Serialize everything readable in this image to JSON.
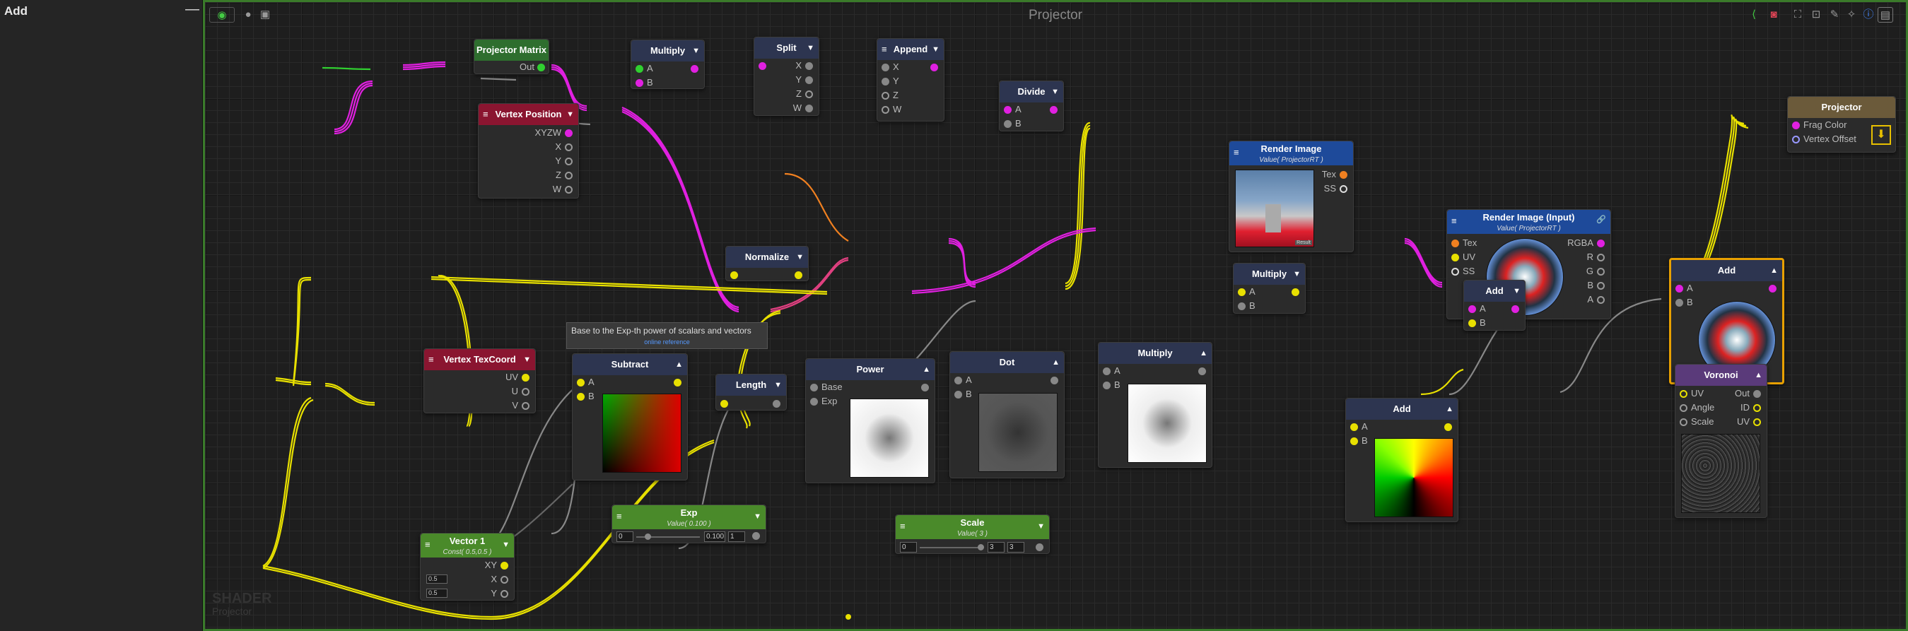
{
  "sidebar": {
    "title": "Add",
    "minimize": "—"
  },
  "graph": {
    "title": "Projector"
  },
  "watermark": {
    "line1": "SHADER",
    "line2": "Projector"
  },
  "colors": {
    "hdr_green": "#2e6e2e",
    "hdr_red": "#8a1530",
    "hdr_navy": "#2d3550",
    "hdr_blue": "#1e4a9a",
    "hdr_purple": "#5a3a7a",
    "hdr_lime": "#4a8a2a",
    "hdr_out": "#6b5a3a",
    "wire_y": "#e8e000",
    "wire_m": "#e020e0",
    "accent_sel": "#e8a000"
  },
  "nodes": {
    "projector_matrix": {
      "title": "Projector Matrix",
      "out": "Out"
    },
    "vertex_position": {
      "title": "Vertex Position",
      "xyzw": "XYZW",
      "x": "X",
      "y": "Y",
      "z": "Z",
      "w": "W"
    },
    "multiply1": {
      "title": "Multiply",
      "a": "A",
      "b": "B"
    },
    "split": {
      "title": "Split",
      "x": "X",
      "y": "Y",
      "z": "Z",
      "w": "W"
    },
    "append": {
      "title": "Append",
      "x": "X",
      "y": "Y",
      "z": "Z",
      "w": "W"
    },
    "divide": {
      "title": "Divide",
      "a": "A",
      "b": "B"
    },
    "render_image": {
      "title": "Render Image",
      "sub": "Value( ProjectorRT )",
      "tex": "Tex",
      "ss": "SS",
      "badge": "Result"
    },
    "render_image_input": {
      "title": "Render Image (Input)",
      "sub": "Value( ProjectorRT )",
      "tex": "Tex",
      "uv": "UV",
      "ss": "SS",
      "rgba": "RGBA",
      "r": "R",
      "g": "G",
      "b": "B",
      "a": "A"
    },
    "projector_out": {
      "title": "Projector",
      "frag": "Frag Color",
      "vertex": "Vertex Offset"
    },
    "add_final": {
      "title": "Add",
      "a": "A",
      "b": "B"
    },
    "add_mid": {
      "title": "Add",
      "a": "A",
      "b": "B"
    },
    "normalize": {
      "title": "Normalize"
    },
    "multiply2": {
      "title": "Multiply",
      "a": "A",
      "b": "B"
    },
    "vertex_texcoord": {
      "title": "Vertex TexCoord",
      "uv": "UV",
      "u": "U",
      "v": "V"
    },
    "subtract": {
      "title": "Subtract",
      "a": "A",
      "b": "B"
    },
    "length": {
      "title": "Length"
    },
    "power": {
      "title": "Power",
      "base": "Base",
      "exp": "Exp"
    },
    "dot": {
      "title": "Dot",
      "a": "A",
      "b": "B"
    },
    "multiply3": {
      "title": "Multiply",
      "a": "A",
      "b": "B"
    },
    "add_low": {
      "title": "Add",
      "a": "A",
      "b": "B"
    },
    "voronoi": {
      "title": "Voronoi",
      "uv": "UV",
      "angle": "Angle",
      "scale": "Scale",
      "out": "Out",
      "id": "ID",
      "uv_out": "UV"
    },
    "exp": {
      "title": "Exp",
      "sub": "Value( 0.100 )",
      "min": "0",
      "val": "0.100",
      "max": "1"
    },
    "scale": {
      "title": "Scale",
      "sub": "Value( 3 )",
      "min": "0",
      "val": "3",
      "max": "3"
    },
    "vector1": {
      "title": "Vector 1",
      "sub": "Const( 0.5,0.5 )",
      "xy": "XY",
      "x": "X",
      "y": "Y",
      "xv": "0.5",
      "yv": "0.5"
    }
  },
  "tooltip": {
    "text": "Base to the Exp-th power of scalars and vectors",
    "link": "online reference"
  },
  "toolbar_icons": [
    "share-icon",
    "camera-icon",
    "frame-icon",
    "fit-icon",
    "settings-icon",
    "info-icon",
    "panel-icon"
  ]
}
